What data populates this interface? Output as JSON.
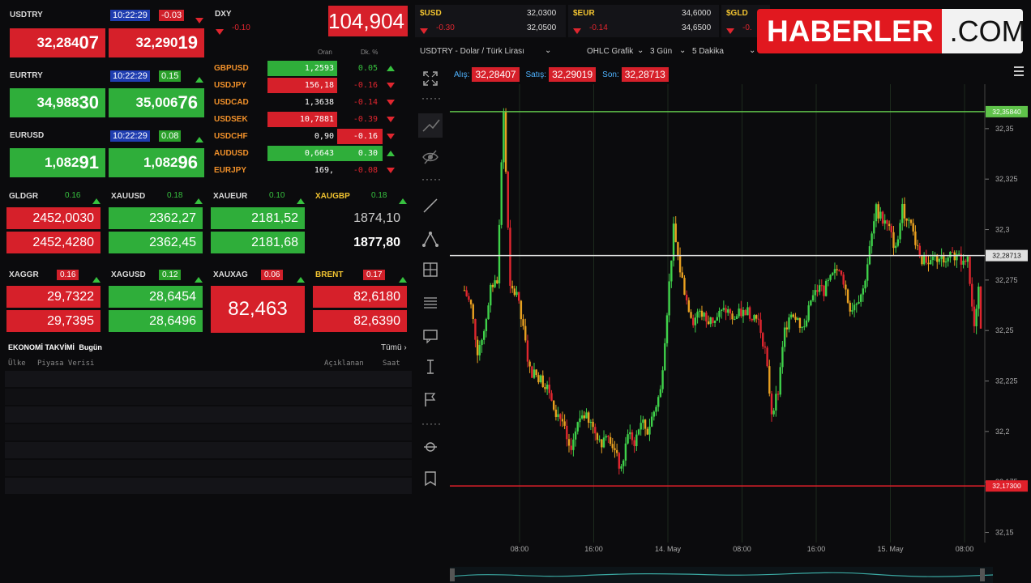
{
  "colors": {
    "up": "#2fae3a",
    "down": "#d6202a",
    "accent_yellow": "#f0c230",
    "time_blue": "#1f3db0"
  },
  "tiles_fx": [
    {
      "name": "USDTRY",
      "time": "10:22:29",
      "change": "-0.03",
      "dir": "down",
      "bid_a": "32,284",
      "bid_b": "07",
      "ask_a": "32,290",
      "ask_b": "19"
    },
    {
      "name": "EURTRY",
      "time": "10:22:29",
      "change": "0.15",
      "dir": "up",
      "bid_a": "34,988",
      "bid_b": "30",
      "ask_a": "35,006",
      "ask_b": "76"
    },
    {
      "name": "EURUSD",
      "time": "10:22:29",
      "change": "0.08",
      "dir": "up",
      "bid_a": "1,082",
      "bid_b": "91",
      "ask_a": "1,082",
      "ask_b": "96"
    }
  ],
  "dxy": {
    "name": "DXY",
    "change": "-0.10",
    "value": "104,904"
  },
  "fx_table": {
    "col_rate": "Oran",
    "col_change": "Dk. %",
    "rows": [
      {
        "name": "GBPUSD",
        "rate": "1,2593",
        "change": "0.05",
        "dir": "up"
      },
      {
        "name": "USDJPY",
        "rate": "156,18",
        "change": "-0.16",
        "dir": "down"
      },
      {
        "name": "USDCAD",
        "rate": "1,3638",
        "change": "-0.14",
        "dir": "down"
      },
      {
        "name": "USDSEK",
        "rate": "10,7881",
        "change": "-0.39",
        "dir": "down"
      },
      {
        "name": "USDCHF",
        "rate": "0,90",
        "change": "-0.16",
        "dir": "down"
      },
      {
        "name": "AUDUSD",
        "rate": "0,6643",
        "change": "0.30",
        "dir": "up"
      },
      {
        "name": "EURJPY",
        "rate": "169,",
        "change": "-0.08",
        "dir": "down"
      }
    ]
  },
  "metals1": [
    {
      "name": "GLDGR",
      "change": "0.16",
      "top": "2452,0030",
      "bottom": "2452,4280",
      "c1": "red",
      "c2": "red"
    },
    {
      "name": "XAUUSD",
      "change": "0.18",
      "top": "2362,27",
      "bottom": "2362,45",
      "c1": "green",
      "c2": "green"
    },
    {
      "name": "XAUEUR",
      "change": "0.10",
      "top": "2181,52",
      "bottom": "2181,68",
      "c1": "green",
      "c2": "green"
    },
    {
      "name": "XAUGBP",
      "change": "0.18",
      "top": "1874,10",
      "bottom": "1877,80",
      "c1": "black",
      "c2": "black"
    }
  ],
  "metals2": [
    {
      "name": "XAGGR",
      "change": "0.16",
      "top": "29,7322",
      "bottom": "29,7395",
      "c1": "red",
      "c2": "red"
    },
    {
      "name": "XAGUSD",
      "change": "0.12",
      "top": "28,6454",
      "bottom": "28,6496",
      "c1": "green",
      "c2": "green"
    },
    {
      "name": "XAUXAG",
      "change": "0.06",
      "single": "82,463",
      "c1": "red"
    },
    {
      "name": "BRENT",
      "change": "0.17",
      "top": "82,6180",
      "bottom": "82,6390",
      "c1": "red",
      "c2": "red"
    }
  ],
  "calendar": {
    "title": "EKONOMİ TAKVİMİ",
    "subtitle": "Bugün",
    "all_link": "Tümü",
    "col_country": "Ülke",
    "col_data": "Piyasa Verisi",
    "col_announced": "Açıklanan",
    "col_time": "Saat"
  },
  "top_tiles": [
    {
      "name": "$USD",
      "v1": "32,0300",
      "v2": "32,0500",
      "change": "-0.30"
    },
    {
      "name": "$EUR",
      "v1": "34,6000",
      "v2": "34,6500",
      "change": "-0.14"
    },
    {
      "name": "$GLD",
      "v1": "",
      "v2": "",
      "change": "-0."
    }
  ],
  "logo": {
    "part1": "HABERLER",
    "part2": ".COM"
  },
  "chart_toolbar": {
    "instrument": "USDTRY - Dolar / Türk Lirası",
    "chart_type": "OHLC Grafik",
    "range": "3 Gün",
    "interval": "5 Dakika"
  },
  "quote_bar": {
    "bid_label": "Alış:",
    "bid": "32,28407",
    "ask_label": "Satış:",
    "ask": "32,29019",
    "last_label": "Son:",
    "last": "32,28713"
  },
  "chart_data": {
    "type": "candlestick",
    "y_ticks": [
      "32,35",
      "32,325",
      "32,3",
      "32,275",
      "32,25",
      "32,225",
      "32,2",
      "32,175",
      "32,15"
    ],
    "y_tick_values": [
      32.35,
      32.325,
      32.3,
      32.275,
      32.25,
      32.225,
      32.2,
      32.175,
      32.15
    ],
    "ylim": [
      32.145,
      32.372
    ],
    "x_ticks": [
      "08:00",
      "16:00",
      "14. May",
      "08:00",
      "16:00",
      "15. May",
      "08:00"
    ],
    "high_line": {
      "label": "32,35840",
      "value": 32.3584
    },
    "last_line": {
      "label": "32,28713",
      "value": 32.28713
    },
    "low_line": {
      "label": "32,17300",
      "value": 32.173
    },
    "close_path": [
      32.27,
      32.262,
      32.24,
      32.25,
      32.27,
      32.275,
      32.3584,
      32.27,
      32.268,
      32.25,
      32.23,
      32.228,
      32.225,
      32.22,
      32.21,
      32.205,
      32.19,
      32.2,
      32.21,
      32.205,
      32.2,
      32.195,
      32.2,
      32.19,
      32.18,
      32.2,
      32.195,
      32.205,
      32.2,
      32.21,
      32.22,
      32.26,
      32.3,
      32.28,
      32.265,
      32.255,
      32.26,
      32.255,
      32.255,
      32.258,
      32.26,
      32.255,
      32.258,
      32.26,
      32.258,
      32.255,
      32.24,
      32.21,
      32.22,
      32.25,
      32.26,
      32.255,
      32.25,
      32.265,
      32.27,
      32.27,
      32.275,
      32.28,
      32.275,
      32.26,
      32.265,
      32.27,
      32.29,
      32.31,
      32.305,
      32.3,
      32.29,
      32.31,
      32.305,
      32.295,
      32.285,
      32.283,
      32.285,
      32.287,
      32.286,
      32.287,
      32.285,
      32.286,
      32.25,
      32.287
    ]
  }
}
